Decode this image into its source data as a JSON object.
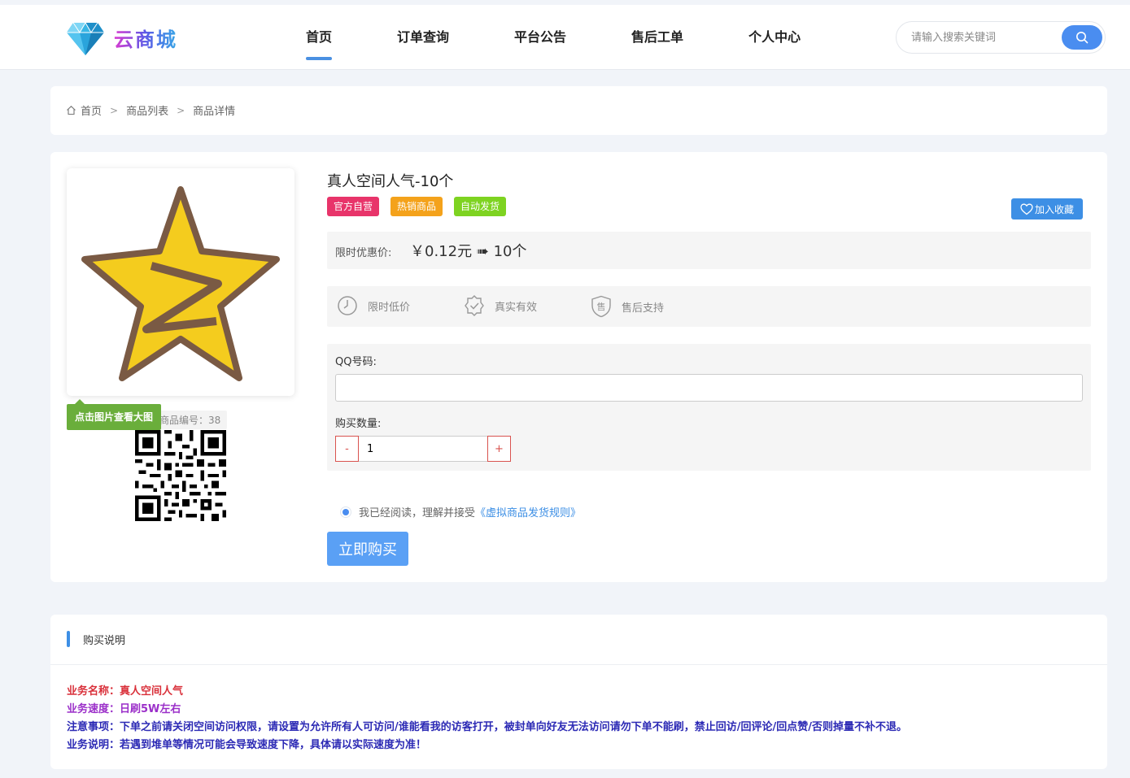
{
  "header": {
    "logo_text": "云商城",
    "nav": [
      "首页",
      "订单查询",
      "平台公告",
      "售后工单",
      "个人中心"
    ],
    "active_nav": "首页",
    "search_placeholder": "请输入搜索关键词"
  },
  "breadcrumb": [
    "首页",
    "商品列表",
    "商品详情"
  ],
  "product": {
    "image_tip": "点击图片查看大图",
    "id_label": "商品编号：38",
    "title": "真人空间人气-10个",
    "tags": [
      {
        "label": "官方自营",
        "color": "#e8346a"
      },
      {
        "label": "热销商品",
        "color": "#f4a21b"
      },
      {
        "label": "自动发货",
        "color": "#7ed321"
      }
    ],
    "fav_label": "加入收藏",
    "price_label": "限时优惠价:",
    "price_value": "￥0.12元 ➠ 10个",
    "features": [
      "限时低价",
      "真实有效",
      "售后支持"
    ],
    "qq_label": "QQ号码:",
    "qq_value": "",
    "qty_label": "购买数量:",
    "qty_minus": "-",
    "qty_plus": "+",
    "qty_value": "1",
    "agree_text": "我已经阅读，理解并接受",
    "agree_link": "《虚拟商品发货规则》",
    "buy_label": "立即购买"
  },
  "description": {
    "title": "购买说明",
    "lines": [
      "业务名称：真人空间人气",
      "业务速度：日刷5W左右",
      "注意事项：下单之前请关闭空间访问权限，请设置为允许所有人可访问/谁能看我的访客打开，被封单向好友无法访问请勿下单不能刷，禁止回访/回评论/回点赞/否则掉量不补不退。",
      "业务说明：若遇到堆单等情况可能会导致速度下降，具体请以实际速度为准！"
    ]
  }
}
